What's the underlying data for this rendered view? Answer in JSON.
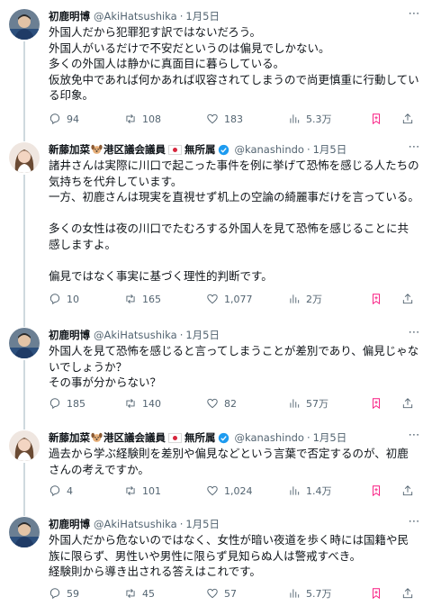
{
  "tweets": [
    {
      "name": "初鹿明博",
      "handle": "@AkiHatsushika",
      "time": "1月5日",
      "body": "外国人だから犯罪犯す訳ではないだろう。\n外国人がいるだけで不安だというのは偏見でしかない。\n多くの外国人は静かに真面目に暮らしている。\n仮放免中であれば何かあれば収容されてしまうので尚更慎重に行動している印象。",
      "replies": "94",
      "retweets": "108",
      "likes": "183",
      "views": "5.3万"
    },
    {
      "name": "新藤加菜",
      "name_suffix": "港区議会議員",
      "party": "無所属",
      "handle": "@kanashindo",
      "time": "1月5日",
      "body": "諸井さんは実際に川口で起こった事件を例に挙げて恐怖を感じる人たちの気持ちを代弁しています。\n一方、初鹿さんは現実を直視せず机上の空論の綺麗事だけを言っている。\n\n多くの女性は夜の川口でたむろする外国人を見て恐怖を感じることに共感しますよ。\n\n偏見ではなく事実に基づく理性的判断です。",
      "replies": "10",
      "retweets": "165",
      "likes": "1,077",
      "views": "2万"
    },
    {
      "name": "初鹿明博",
      "handle": "@AkiHatsushika",
      "time": "1月5日",
      "body": "外国人を見て恐怖を感じると言ってしまうことが差別であり、偏見じゃないでしょうか？\nその事が分からない？",
      "replies": "185",
      "retweets": "140",
      "likes": "82",
      "views": "57万"
    },
    {
      "name": "新藤加菜",
      "name_suffix": "港区議会議員",
      "party": "無所属",
      "handle": "@kanashindo",
      "time": "1月5日",
      "body": "過去から学ぶ経験則を差別や偏見などという言葉で否定するのが、初鹿さんの考えですか。",
      "replies": "4",
      "retweets": "101",
      "likes": "1,024",
      "views": "1.4万"
    },
    {
      "name": "初鹿明博",
      "handle": "@AkiHatsushika",
      "time": "1月5日",
      "body": "外国人だから危ないのではなく、女性が暗い夜道を歩く時には国籍や民族に限らず、男性いや男性に限らず見知らぬ人は警戒すべき。\n経験則から導き出される答えはこれです。",
      "replies": "59",
      "retweets": "45",
      "likes": "57",
      "views": "5.7万"
    }
  ],
  "icons": {
    "more": "more-icon",
    "reply": "reply-icon",
    "retweet": "retweet-icon",
    "like": "heart-icon",
    "views": "views-icon",
    "bookmark": "bookmark-icon",
    "share": "share-icon",
    "verified": "verified-badge-icon",
    "dog": "dog-emoji-icon",
    "flag": "japan-flag-icon"
  },
  "colors": {
    "text": "#0f1419",
    "secondary": "#536471",
    "thread_line": "#cfd9de",
    "verified": "#1d9bf0",
    "bookmark": "#f91880"
  }
}
